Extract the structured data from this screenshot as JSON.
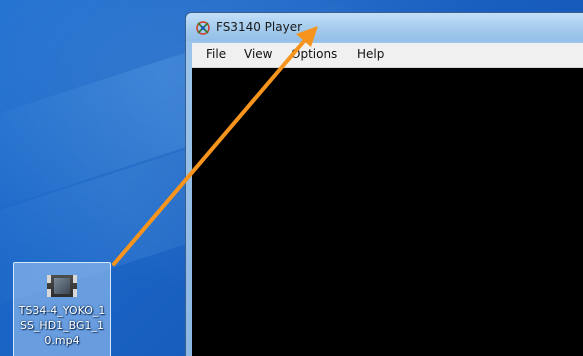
{
  "window": {
    "title": "FS3140 Player",
    "icon": "app-icon"
  },
  "menu": {
    "file": "File",
    "view": "View",
    "options": "Options",
    "help": "Help"
  },
  "desktop": {
    "file_icon": {
      "name": "TS34-4_YOKO_1SS_HD1_BG1_10.mp4",
      "icon": "video-file-icon"
    }
  },
  "annotation": {
    "arrow": "drag-arrow",
    "color": "#f7941d"
  },
  "colors": {
    "desktop": "#1a63c4",
    "video_bg": "#000000",
    "menubar_bg": "#f0f0f0"
  }
}
